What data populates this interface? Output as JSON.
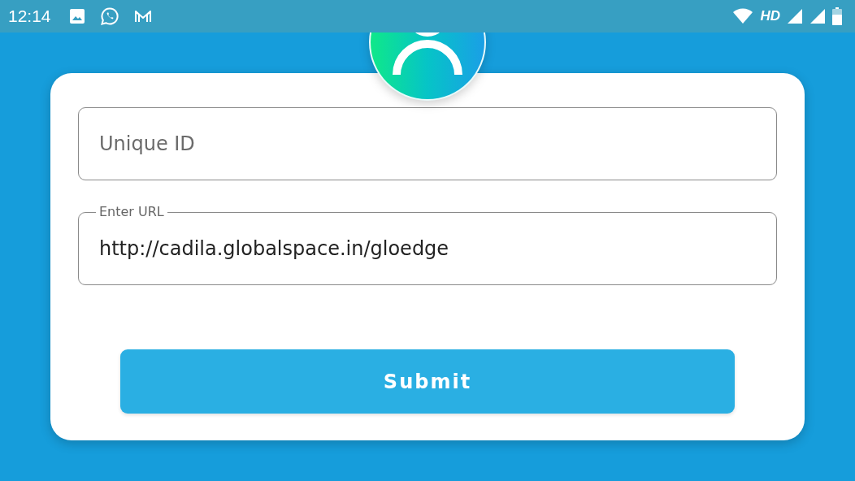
{
  "status_bar": {
    "time": "12:14",
    "network_label": "HD"
  },
  "form": {
    "fields": [
      {
        "kind": "plain",
        "placeholder": "Unique ID"
      },
      {
        "kind": "outlined",
        "label": "Enter URL",
        "value": "http://cadila.globalspace.in/gloedge"
      }
    ],
    "submit_button": "Submit"
  }
}
